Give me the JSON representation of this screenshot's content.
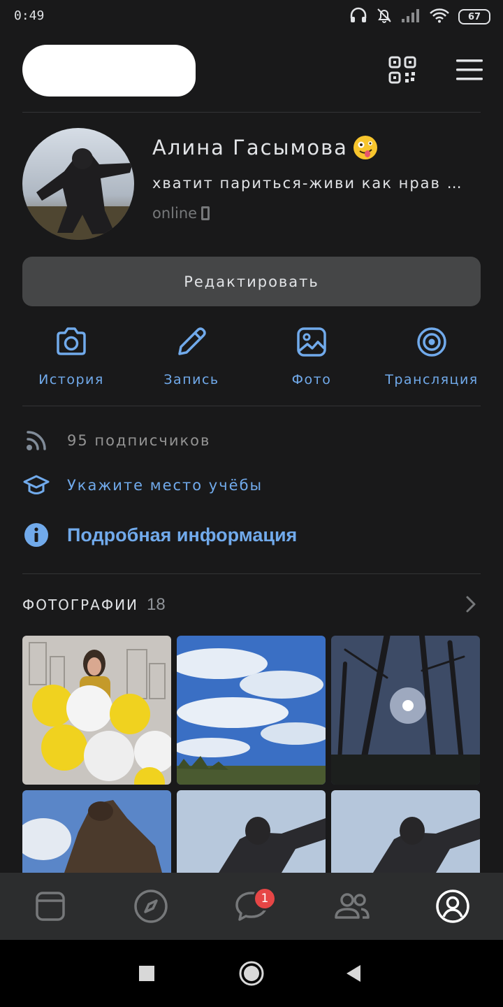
{
  "status_bar": {
    "time": "0:49",
    "battery": "67"
  },
  "profile": {
    "name": "Алина Гасымова",
    "status": "хватит париться-живи как нрав …",
    "online": "online"
  },
  "edit_label": "Редактировать",
  "actions": [
    {
      "label": "История",
      "icon": "camera-icon"
    },
    {
      "label": "Запись",
      "icon": "pencil-icon"
    },
    {
      "label": "Фото",
      "icon": "image-icon"
    },
    {
      "label": "Трансляция",
      "icon": "broadcast-icon"
    }
  ],
  "info": {
    "followers": "95 подписчиков",
    "education": "Укажите место учёбы",
    "details": "Подробная информация"
  },
  "photos": {
    "title": "Фотографии",
    "count": "18"
  },
  "tab_bar": {
    "items": [
      "news-icon",
      "discover-icon",
      "messages-icon",
      "friends-icon",
      "profile-icon"
    ],
    "messages_badge": "1"
  },
  "colors": {
    "background": "#19191a",
    "accent": "#71aaeb",
    "button": "#454647",
    "tab_bar": "#2c2d2e",
    "badge": "#e64646"
  }
}
